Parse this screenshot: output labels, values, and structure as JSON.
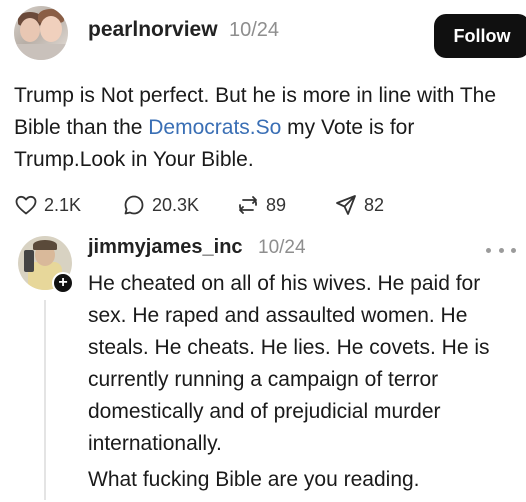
{
  "post": {
    "username": "pearlnorview",
    "time": "10/24",
    "follow_label": "Follow",
    "text_before_link": "Trump is Not perfect. But he is more in line with The Bible than the ",
    "link_text": "Democrats.So",
    "text_after_link": " my Vote is for Trump.Look in Your Bible."
  },
  "actions": {
    "likes": "2.1K",
    "replies": "20.3K",
    "reposts": "89",
    "shares": "82"
  },
  "reply": {
    "username": "jimmyjames_inc",
    "time": "10/24",
    "paragraph1": "He cheated on all of his wives. He paid for sex. He raped and assaulted women. He steals. He cheats. He lies. He covets. He is currently running a campaign of terror domestically and of prejudicial murder internationally.",
    "paragraph2": "What fucking Bible are you reading."
  },
  "icons": [
    "heart-icon",
    "comment-icon",
    "repost-icon",
    "share-icon",
    "more-icon",
    "plus-icon"
  ],
  "colors": {
    "link": "#3a6fb5",
    "follow_bg": "#101010",
    "muted": "#8e8e8e"
  }
}
